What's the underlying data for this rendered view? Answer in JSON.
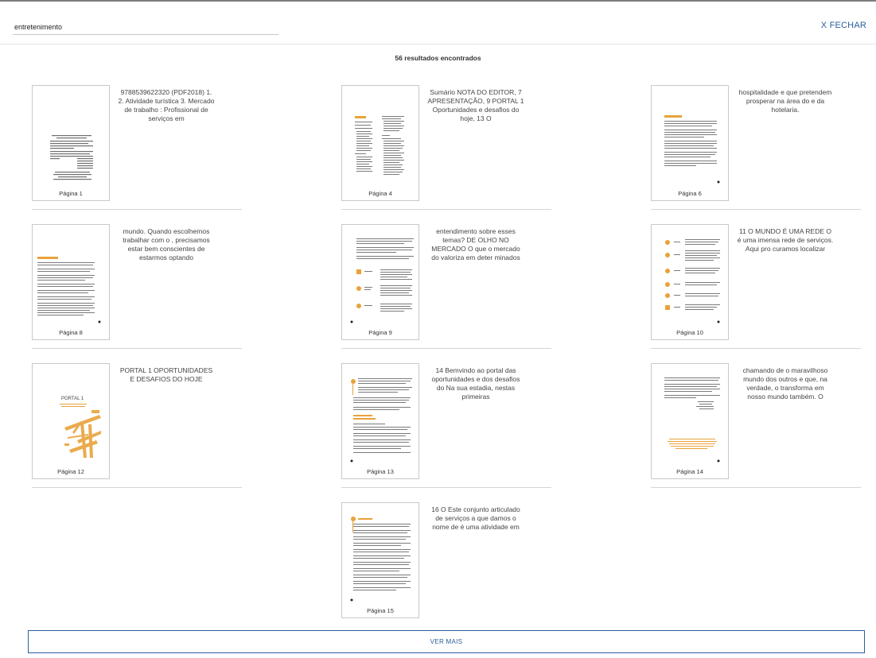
{
  "search": {
    "value": "entretenimento",
    "close_label": "X FECHAR"
  },
  "results_count": "56 resultados encontrados",
  "results": [
    {
      "page": "Página 1",
      "snippet": "9788539622320 (PDF2018) 1. 2. Atividade turística 3. Mercado de trabalho : Profissional de serviços em"
    },
    {
      "page": "Página 4",
      "snippet": "Sumário NOTA DO EDITOR, 7 APRESENTAÇÃO, 9 PORTAL 1 Oportunidades e desafios do hoje, 13 O"
    },
    {
      "page": "Página 6",
      "snippet": "hospitalidade e que pretendem prosperar na área do e da hotelaria."
    },
    {
      "page": "Página 8",
      "snippet": "mundo. Quando escolhemos trabalhar com o , precisamos estar bem conscientes de estarmos optando"
    },
    {
      "page": "Página 9",
      "snippet": "entendimento sobre esses temas? DE OLHO NO MERCADO O que o mercado do valoriza em deter minados"
    },
    {
      "page": "Página 10",
      "snippet": "11 O MUNDO É UMA REDE O é uma imensa rede de serviços. Aqui pro curamos localizar"
    },
    {
      "page": "Página 12",
      "snippet": "PORTAL 1 OPORTUNIDADES E DESAFIOS DO HOJE",
      "thumb_title": "PORTAL 1"
    },
    {
      "page": "Página 13",
      "snippet": "14 Bemvindo ao portal das oportunidades e dos desafios do Na sua estadia, nestas primeiras"
    },
    {
      "page": "Página 14",
      "snippet": "chamando de o maravilhoso mundo dos outros e que, na verdade, o transforma em nosso mundo também. O"
    },
    {
      "page": "Página 15",
      "snippet": "16 O Este conjunto articulado de serviços a que damos o nome de é uma atividade em"
    }
  ],
  "more_label": "VER MAIS",
  "colors": {
    "accent": "#2b5f9e",
    "thumb_orange": "#e8a23a"
  }
}
